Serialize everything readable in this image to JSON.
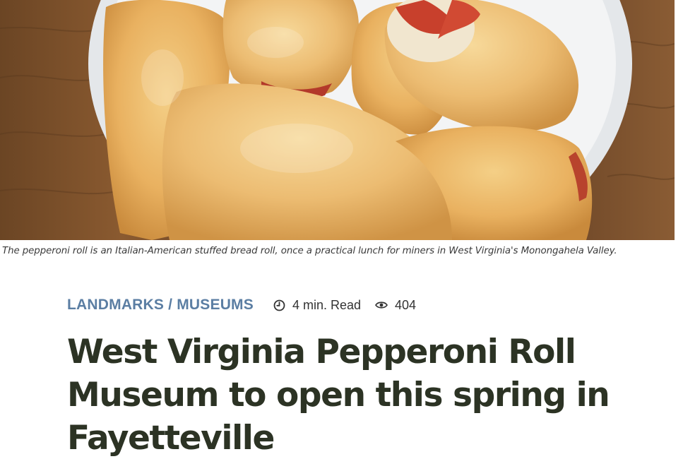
{
  "hero": {
    "caption": "The pepperoni roll is an Italian-American stuffed bread roll, once a practical lunch for miners in West Virginia's Monongahela Valley."
  },
  "article": {
    "category": "LANDMARKS / MUSEUMS",
    "read_time": "4 min. Read",
    "views": "404",
    "title": "West Virginia Pepperoni Roll Museum to open this spring in Fayetteville"
  },
  "icons": {
    "read_time": "clock-icon",
    "views": "eye-icon"
  },
  "colors": {
    "category": "#5b7ea3",
    "title": "#2c3324",
    "caption": "#3a3a3a"
  }
}
